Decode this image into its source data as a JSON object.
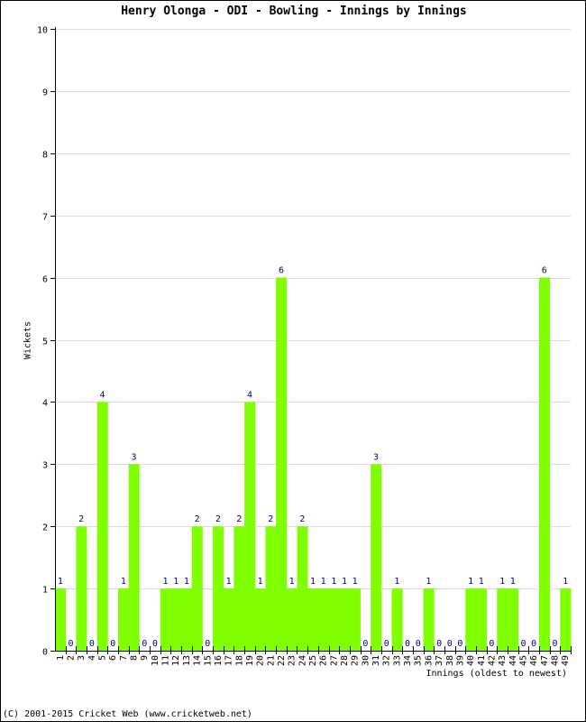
{
  "chart_data": {
    "type": "bar",
    "title": "Henry Olonga - ODI - Bowling - Innings by Innings",
    "xlabel": "Innings (oldest to newest)",
    "ylabel": "Wickets",
    "ylim": [
      0,
      10
    ],
    "yticks": [
      "0",
      "1",
      "2",
      "3",
      "4",
      "5",
      "6",
      "7",
      "8",
      "9",
      "10"
    ],
    "grid": true,
    "categories": [
      "1",
      "2",
      "3",
      "4",
      "5",
      "6",
      "7",
      "8",
      "9",
      "10",
      "11",
      "12",
      "13",
      "14",
      "15",
      "16",
      "17",
      "18",
      "19",
      "20",
      "21",
      "22",
      "23",
      "24",
      "25",
      "26",
      "27",
      "28",
      "29",
      "30",
      "31",
      "32",
      "33",
      "34",
      "35",
      "36",
      "37",
      "38",
      "39",
      "40",
      "41",
      "42",
      "43",
      "44",
      "45",
      "46",
      "47",
      "48",
      "49"
    ],
    "values": [
      1,
      0,
      2,
      0,
      4,
      0,
      1,
      3,
      0,
      0,
      1,
      1,
      1,
      2,
      0,
      2,
      1,
      2,
      4,
      1,
      2,
      6,
      1,
      2,
      1,
      1,
      1,
      1,
      1,
      0,
      3,
      0,
      1,
      0,
      0,
      1,
      0,
      0,
      0,
      1,
      1,
      0,
      1,
      1,
      0,
      0,
      6,
      0,
      1
    ],
    "colors": {
      "bar": "#7fff00",
      "label": "#000080",
      "grid": "#dcdcdc",
      "axis": "#000000"
    }
  },
  "footer": "(C) 2001-2015 Cricket Web (www.cricketweb.net)"
}
